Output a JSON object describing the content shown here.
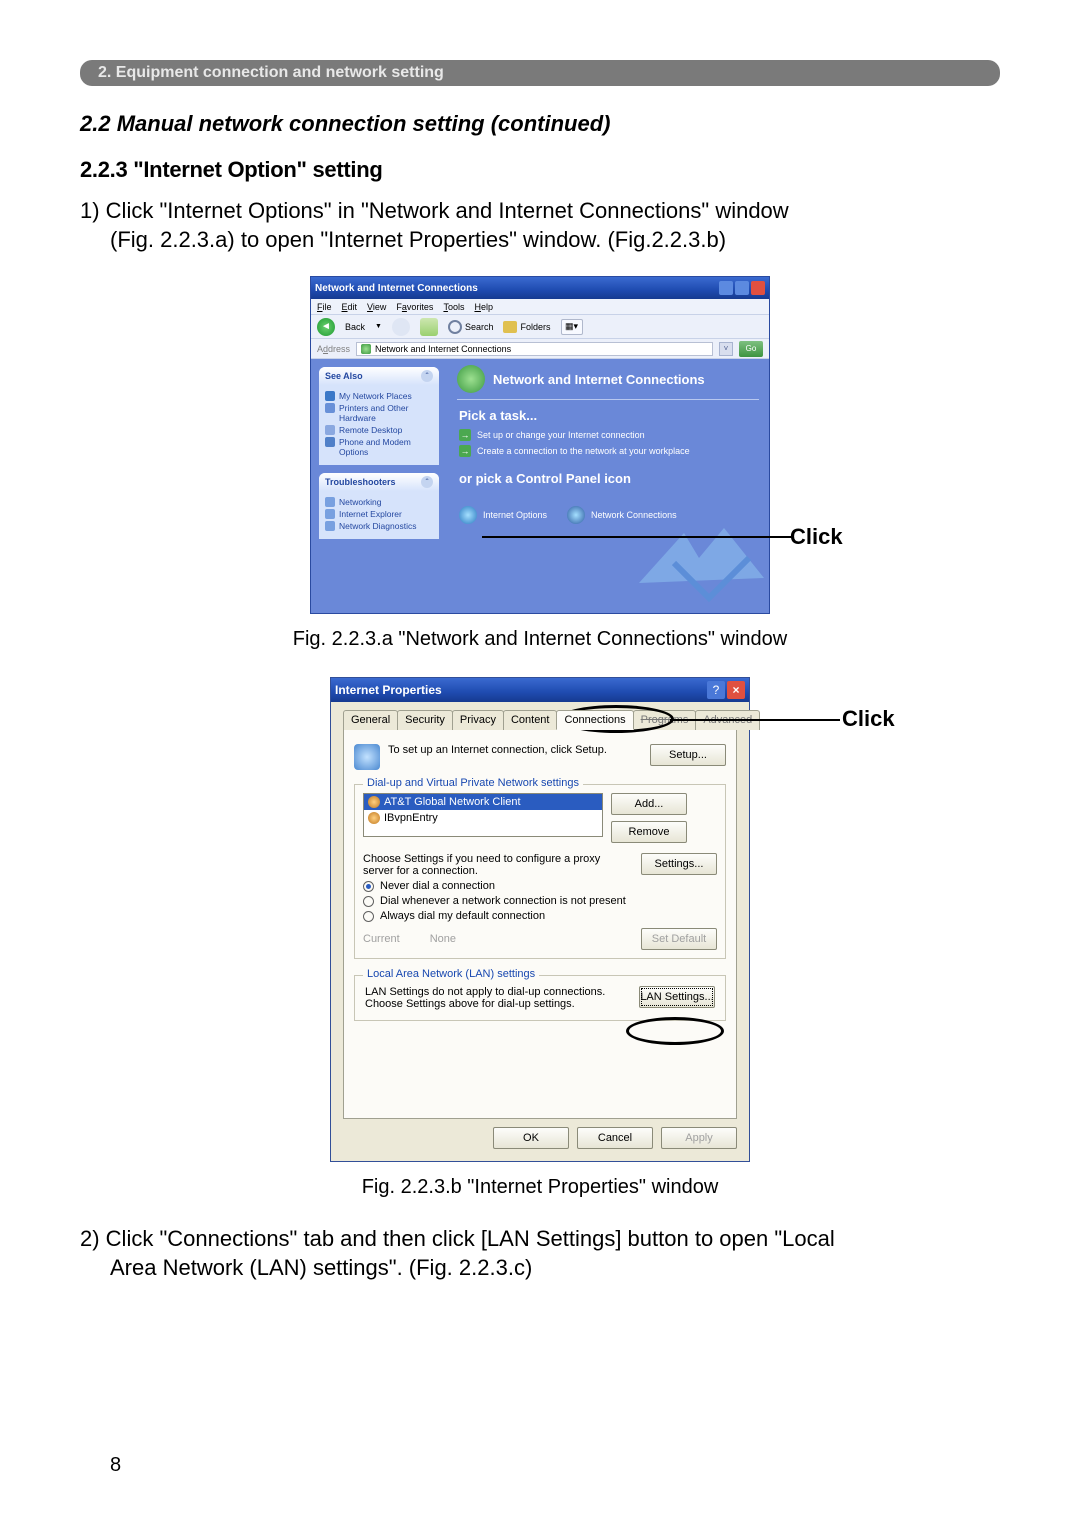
{
  "chapterBar": "2. Equipment connection and network setting",
  "sectionTitle": "2.2 Manual network connection setting (continued)",
  "subsectionTitle": "2.2.3 \"Internet Option\" setting",
  "step1_line1": "1) Click \"Internet Options\" in \"Network and Internet Connections\" window",
  "step1_line2": "(Fig. 2.2.3.a) to open \"Internet Properties\" window. (Fig.2.2.3.b)",
  "captionA": "Fig. 2.2.3.a \"Network and Internet Connections\" window",
  "captionB": "Fig. 2.2.3.b \"Internet Properties\" window",
  "step2_line1": "2) Click \"Connections\" tab and then click [LAN Settings] button to open \"Local",
  "step2_line2": "Area Network (LAN) settings\". (Fig. 2.2.3.c)",
  "pageNumber": "8",
  "clickLabel": "Click",
  "figA": {
    "title": "Network and Internet Connections",
    "menus": [
      "File",
      "Edit",
      "View",
      "Favorites",
      "Tools",
      "Help"
    ],
    "back": "Back",
    "search": "Search",
    "folders": "Folders",
    "addressLabel": "Address",
    "addressValue": "Network and Internet Connections",
    "go": "Go",
    "panel1": {
      "title": "See Also",
      "items": [
        {
          "label": "My Network Places",
          "color": "#3a78c8"
        },
        {
          "label": "Printers and Other Hardware",
          "color": "#6890d8"
        },
        {
          "label": "Remote Desktop",
          "color": "#8aa8e0"
        },
        {
          "label": "Phone and Modem Options",
          "color": "#5080c8"
        }
      ]
    },
    "panel2": {
      "title": "Troubleshooters",
      "items": [
        {
          "label": "Networking",
          "color": "#78a0e0"
        },
        {
          "label": "Internet Explorer",
          "color": "#78a0e0"
        },
        {
          "label": "Network Diagnostics",
          "color": "#78a0e0"
        }
      ]
    },
    "catHeader": "Network and Internet Connections",
    "pickTask": "Pick a task...",
    "task1": "Set up or change your Internet connection",
    "task2": "Create a connection to the network at your workplace",
    "orPick": "or pick a Control Panel icon",
    "cp1": "Internet Options",
    "cp2": "Network Connections"
  },
  "figB": {
    "title": "Internet Properties",
    "tabs": [
      "General",
      "Security",
      "Privacy",
      "Content",
      "Connections",
      "Programs",
      "Advanced"
    ],
    "setupText": "To set up an Internet connection, click Setup.",
    "setupBtn": "Setup...",
    "frame1Title": "Dial-up and Virtual Private Network settings",
    "listItems": [
      "AT&T Global Network Client",
      "IBvpnEntry"
    ],
    "addBtn": "Add...",
    "removeBtn": "Remove",
    "proxyText": "Choose Settings if you need to configure a proxy server for a connection.",
    "settingsBtn": "Settings...",
    "radio1": "Never dial a connection",
    "radio2": "Dial whenever a network connection is not present",
    "radio3": "Always dial my default connection",
    "currentLabel": "Current",
    "currentValue": "None",
    "setDefaultBtn": "Set Default",
    "frame2Title": "Local Area Network (LAN) settings",
    "lanText": "LAN Settings do not apply to dial-up connections. Choose Settings above for dial-up settings.",
    "lanBtn": "LAN Settings...",
    "ok": "OK",
    "cancel": "Cancel",
    "apply": "Apply"
  }
}
